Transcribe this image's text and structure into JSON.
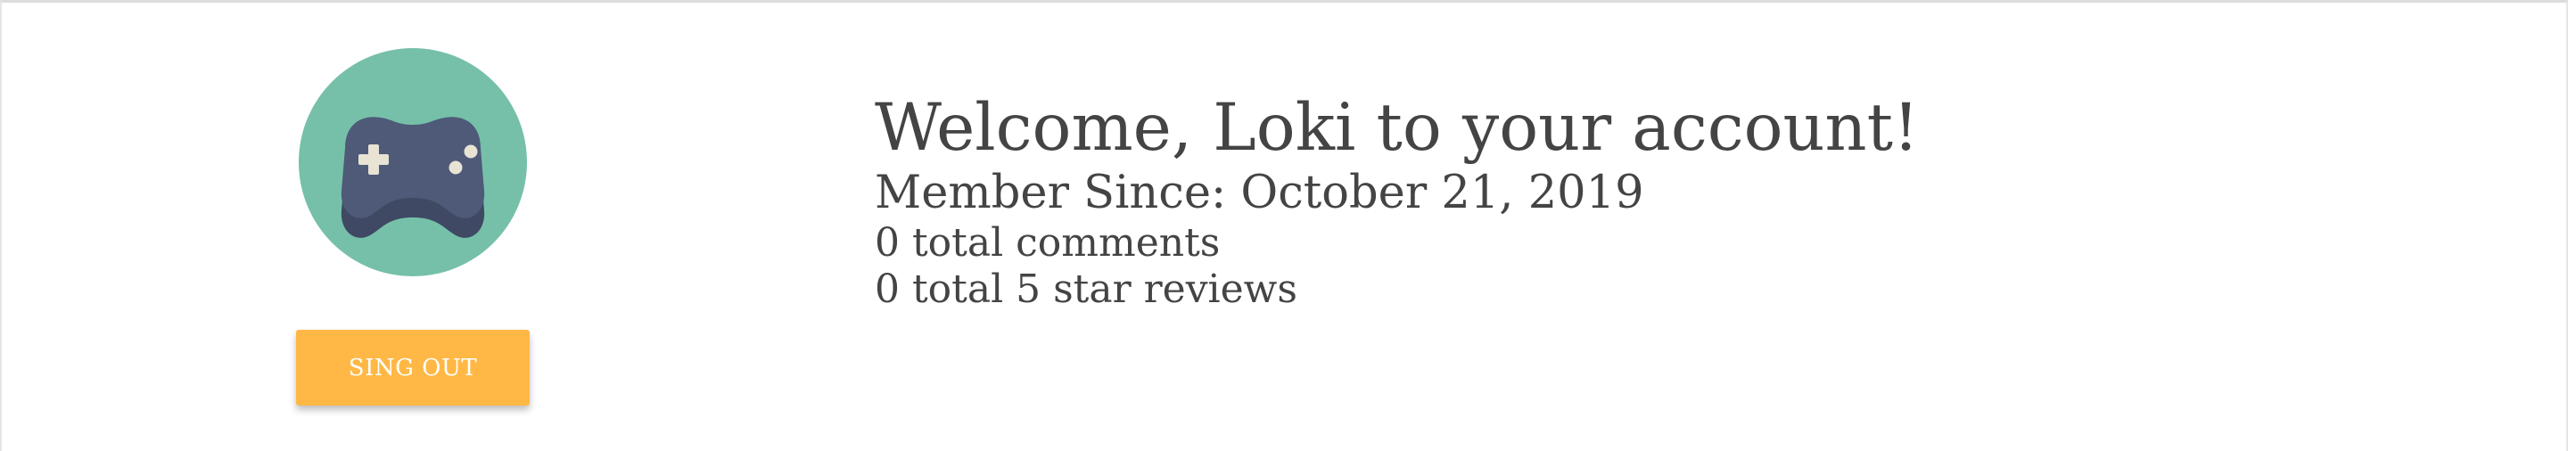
{
  "profile": {
    "avatar_icon": "game-controller-icon",
    "welcome_text": "Welcome, Loki to your account!",
    "member_since": "Member Since: October 21, 2019",
    "comments_count": "0 total comments",
    "reviews_count": "0 total 5 star reviews"
  },
  "actions": {
    "sign_out_label": "SING OUT"
  },
  "colors": {
    "avatar_background": "#76c0aa",
    "controller": "#4e5a78",
    "controller_shadow": "#3f4963",
    "controller_buttons": "#e8e3d3",
    "accent_button": "#ffb845",
    "text": "#444444"
  }
}
